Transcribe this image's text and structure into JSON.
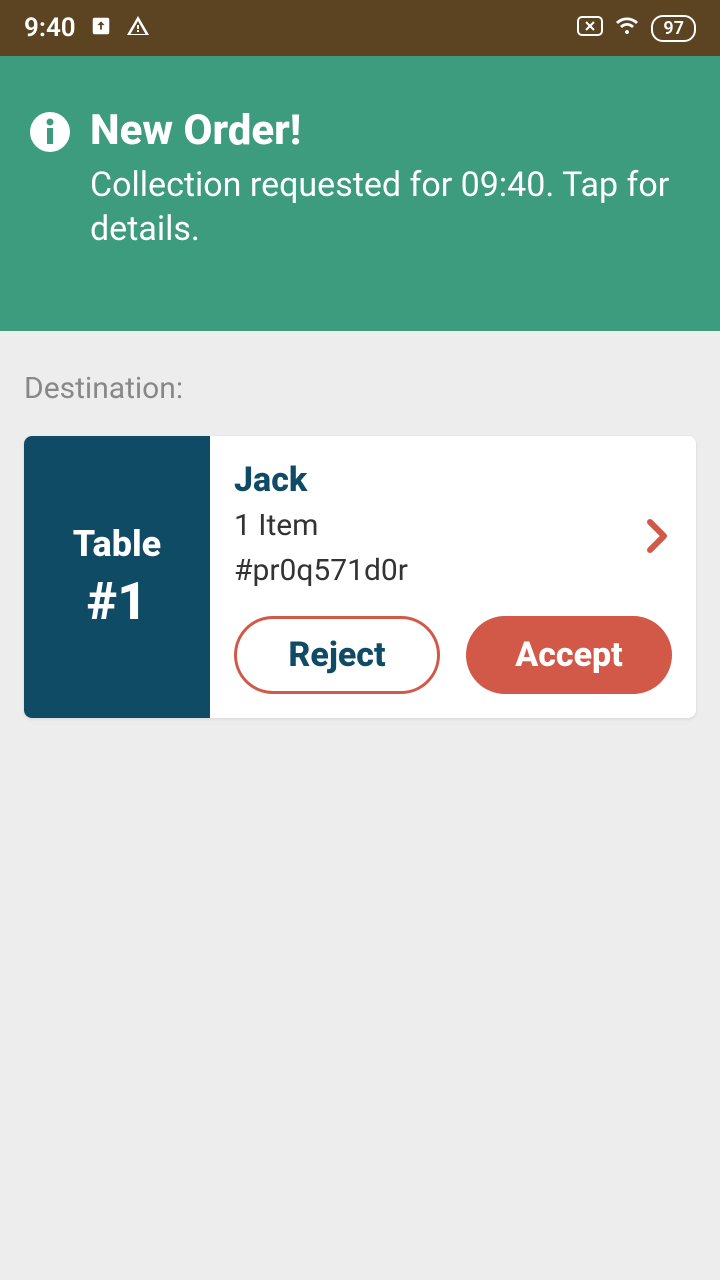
{
  "status_bar": {
    "time": "9:40",
    "battery": "97"
  },
  "banner": {
    "title": "New Order!",
    "subtitle": "Collection requested for 09:40. Tap for details."
  },
  "content": {
    "destination_label": "Destination:",
    "table": {
      "label": "Table",
      "number": "#1"
    },
    "order": {
      "customer_name": "Jack",
      "item_count": "1 Item",
      "order_id": "#pr0q571d0r"
    },
    "buttons": {
      "reject": "Reject",
      "accept": "Accept"
    }
  }
}
